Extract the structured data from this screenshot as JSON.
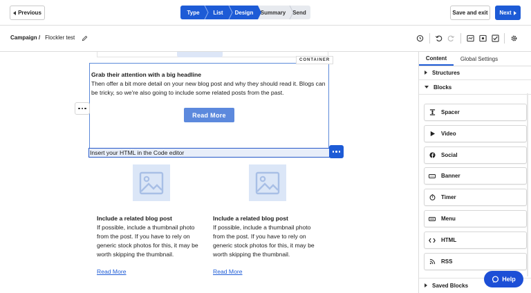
{
  "header": {
    "previous_label": "Previous",
    "save_exit_label": "Save and exit",
    "next_label": "Next",
    "steps": [
      {
        "label": "Type",
        "state": "done"
      },
      {
        "label": "List",
        "state": "done"
      },
      {
        "label": "Design",
        "state": "current"
      },
      {
        "label": "Summary",
        "state": "upcoming"
      },
      {
        "label": "Send",
        "state": "upcoming"
      }
    ],
    "accent_color": "#1d5bd6"
  },
  "subbar": {
    "breadcrumb_root": "Campaign /",
    "campaign_name": "Flockler test",
    "tools": [
      "history-icon",
      "undo-icon",
      "redo-icon",
      "desktop-preview-icon",
      "send-preview-icon",
      "checklist-icon",
      "settings-icon"
    ]
  },
  "canvas": {
    "container_tag": "CONTAINER",
    "headline": "Grab their attention with a big headline",
    "body": "Then offer a bit more detail on your new blog post and why they should read it. Blogs can be tricky, so we're also going to include some related posts from the past.",
    "button_label": "Read More",
    "html_placeholder": "Insert your HTML in the Code editor",
    "posts": [
      {
        "title": "Include a related blog post",
        "body": "If possible, include a thumbnail photo from the post. If you have to rely on generic stock photos for this, it may be worth skipping the thumbnail.",
        "link": "Read More"
      },
      {
        "title": "Include a related blog post",
        "body": "If possible, include a thumbnail photo from the post. If you have to rely on generic stock photos for this, it may be worth skipping the thumbnail.",
        "link": "Read More"
      }
    ]
  },
  "panel": {
    "tabs": [
      "Content",
      "Global Settings"
    ],
    "structures_label": "Structures",
    "blocks_label": "Blocks",
    "blocks": [
      {
        "label": "Spacer",
        "icon": "spacer-icon"
      },
      {
        "label": "Video",
        "icon": "play-icon"
      },
      {
        "label": "Social",
        "icon": "facebook-icon"
      },
      {
        "label": "Banner",
        "icon": "banner-icon"
      },
      {
        "label": "Timer",
        "icon": "timer-icon"
      },
      {
        "label": "Menu",
        "icon": "menu-icon"
      },
      {
        "label": "HTML",
        "icon": "code-icon"
      },
      {
        "label": "RSS",
        "icon": "rss-icon"
      }
    ],
    "saved_blocks_label": "Saved Blocks"
  },
  "help_label": "Help"
}
